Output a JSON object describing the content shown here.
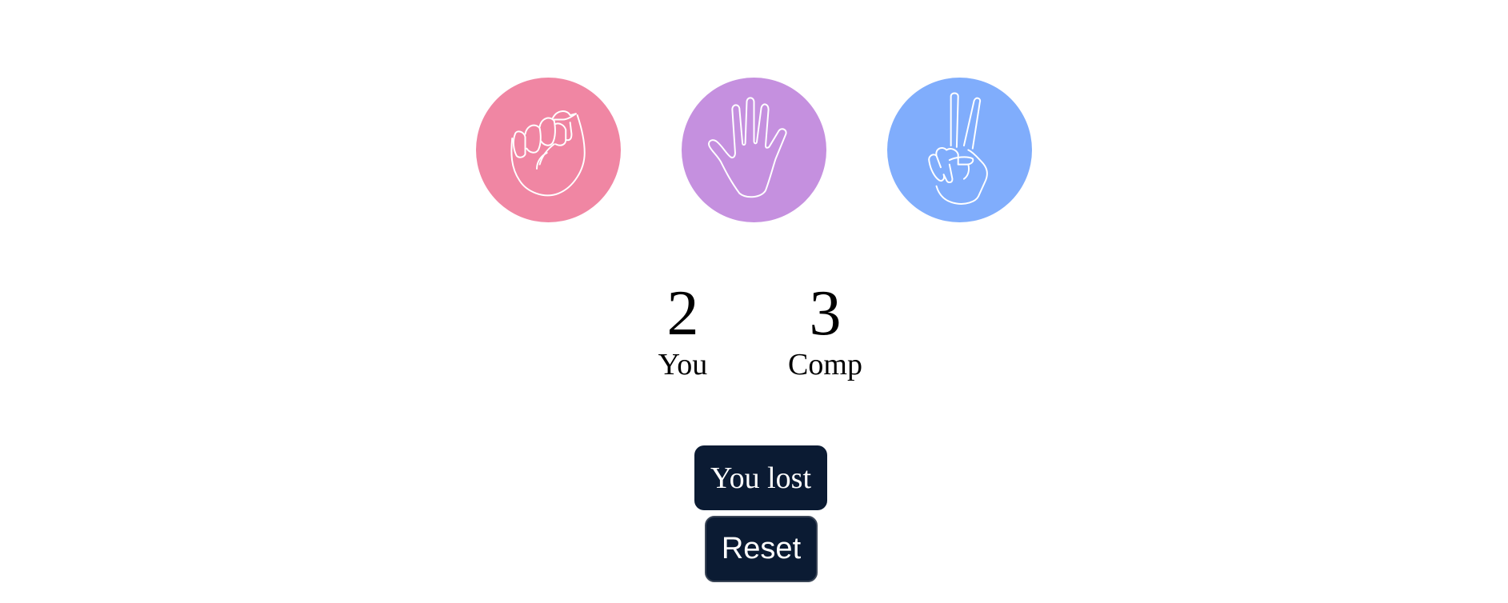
{
  "choices": [
    {
      "name": "rock",
      "icon": "fist-icon",
      "color": "#f086a3"
    },
    {
      "name": "paper",
      "icon": "open-hand-icon",
      "color": "#c590df"
    },
    {
      "name": "scissors",
      "icon": "peace-hand-icon",
      "color": "#80adfc"
    }
  ],
  "scoreboard": {
    "player_score": "2",
    "player_label": "You",
    "computer_score": "3",
    "computer_label": "Comp"
  },
  "result": {
    "text": "You lost",
    "background": "#0b1b33"
  },
  "reset": {
    "label": "Reset",
    "background": "#0b1b33"
  }
}
